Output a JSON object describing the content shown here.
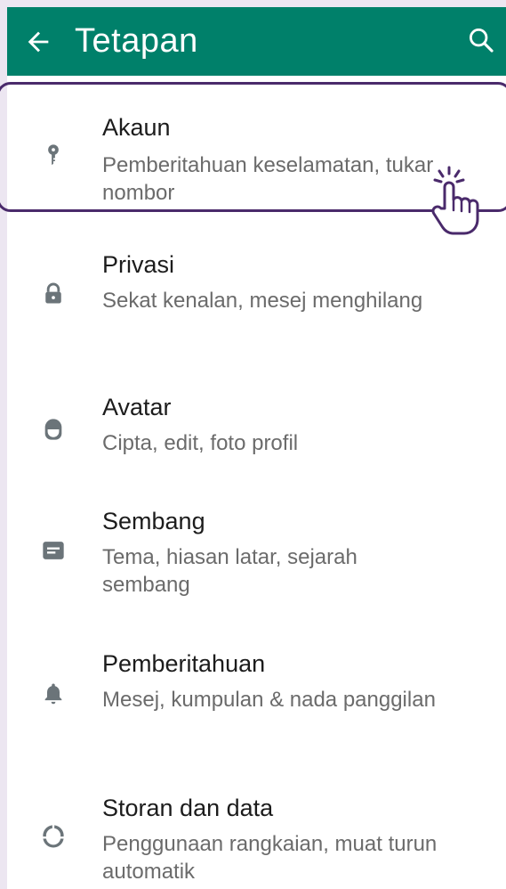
{
  "header": {
    "title": "Tetapan",
    "back_icon": "arrow-left-icon",
    "search_icon": "search-icon",
    "background": "#00806a"
  },
  "items": [
    {
      "label": "Akaun",
      "subtitle": "Pemberitahuan keselamatan, tukar nombor",
      "icon": "key-icon"
    },
    {
      "label": "Privasi",
      "subtitle": "Sekat kenalan, mesej menghilang",
      "icon": "lock-icon"
    },
    {
      "label": "Avatar",
      "subtitle": "Cipta, edit, foto profil",
      "icon": "avatar-icon"
    },
    {
      "label": "Sembang",
      "subtitle": "Tema, hiasan latar, sejarah sembang",
      "icon": "chat-icon"
    },
    {
      "label": "Pemberitahuan",
      "subtitle": "Mesej, kumpulan & nada panggilan",
      "icon": "bell-icon"
    },
    {
      "label": "Storan dan data",
      "subtitle": "Penggunaan rangkaian, muat turun automatik",
      "icon": "data-usage-icon"
    }
  ],
  "colors": {
    "icon": "#6b7479",
    "highlight_border": "#4a2a6b"
  }
}
